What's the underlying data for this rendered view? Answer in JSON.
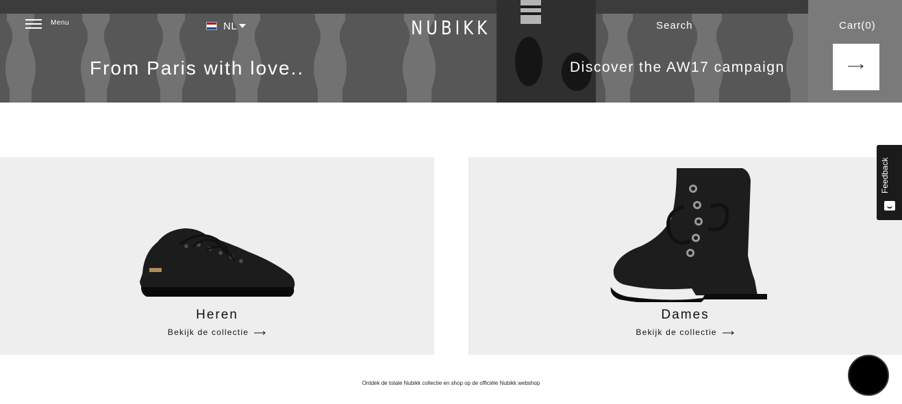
{
  "header": {
    "menu_label": "Menu",
    "language": {
      "code": "NL",
      "flag": "netherlands-flag",
      "flag_colors": [
        "#ae1c28",
        "#ffffff",
        "#21468b"
      ]
    },
    "logo": "NUBIKK",
    "search_label": "Search",
    "cart_label": "Cart",
    "cart_count": "(0)"
  },
  "hero": {
    "tagline": "From Paris with love..",
    "campaign_label": "Discover the AW17 campaign",
    "campaign_button_icon": "arrow-right-icon"
  },
  "categories": [
    {
      "title": "Heren",
      "cta": "Bekijk de collectie",
      "image": "men-black-sneaker"
    },
    {
      "title": "Dames",
      "cta": "Bekijk de collectie",
      "image": "women-black-boot"
    }
  ],
  "footer_note": "Ontdek de totale Nubikk collectie en shop op de officiële Nubikk webshop",
  "feedback_label": "Feedback",
  "colors": {
    "card_bg": "#eeeeee",
    "feedback_bg": "#1b1b1b",
    "chat_bg": "#000000"
  }
}
